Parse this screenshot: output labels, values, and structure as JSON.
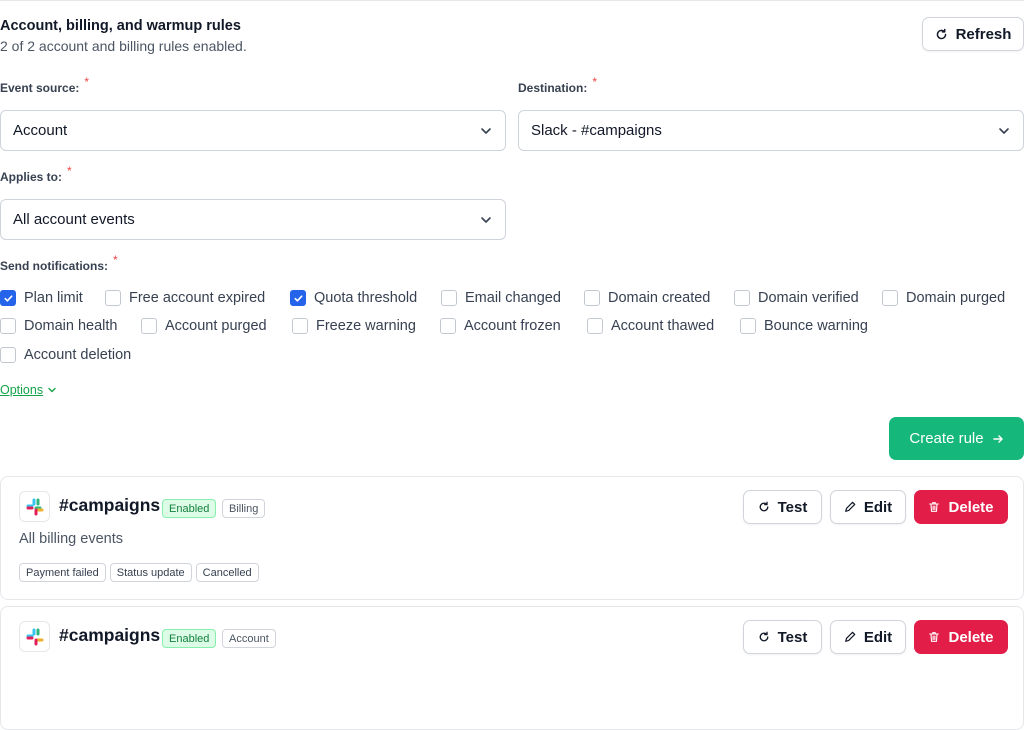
{
  "header": {
    "title": "Account, billing, and warmup rules",
    "subtitle": "2 of 2 account and billing rules enabled.",
    "refresh_label": "Refresh"
  },
  "form": {
    "event_source": {
      "label": "Event source:",
      "required_mark": "*",
      "value": "Account"
    },
    "destination": {
      "label": "Destination:",
      "required_mark": "*",
      "value": "Slack - #campaigns"
    },
    "applies_to": {
      "label": "Applies to:",
      "required_mark": "*",
      "value": "All account events"
    },
    "notifications": {
      "label": "Send notifications:",
      "required_mark": "*",
      "items": [
        {
          "label": "Plan limit",
          "checked": true
        },
        {
          "label": "Free account expired",
          "checked": false
        },
        {
          "label": "Quota threshold",
          "checked": true
        },
        {
          "label": "Email changed",
          "checked": false
        },
        {
          "label": "Domain created",
          "checked": false
        },
        {
          "label": "Domain verified",
          "checked": false
        },
        {
          "label": "Domain purged",
          "checked": false
        },
        {
          "label": "Domain health",
          "checked": false
        },
        {
          "label": "Account purged",
          "checked": false
        },
        {
          "label": "Freeze warning",
          "checked": false
        },
        {
          "label": "Account frozen",
          "checked": false
        },
        {
          "label": "Account thawed",
          "checked": false
        },
        {
          "label": "Bounce warning",
          "checked": false
        },
        {
          "label": "Account deletion",
          "checked": false
        }
      ]
    },
    "options_label": "Options",
    "create_label": "Create rule"
  },
  "rules": [
    {
      "channel": "#campaigns",
      "status": "Enabled",
      "type": "Billing",
      "description": "All billing events",
      "tags": [
        "Payment failed",
        "Status update",
        "Cancelled"
      ],
      "test_label": "Test",
      "edit_label": "Edit",
      "delete_label": "Delete"
    },
    {
      "channel": "#campaigns",
      "status": "Enabled",
      "type": "Account",
      "test_label": "Test",
      "edit_label": "Edit",
      "delete_label": "Delete"
    }
  ],
  "colors": {
    "primary_green": "#16b77a",
    "danger_red": "#e11d48",
    "checkbox_blue": "#2563eb",
    "link_green": "#16a34a"
  }
}
